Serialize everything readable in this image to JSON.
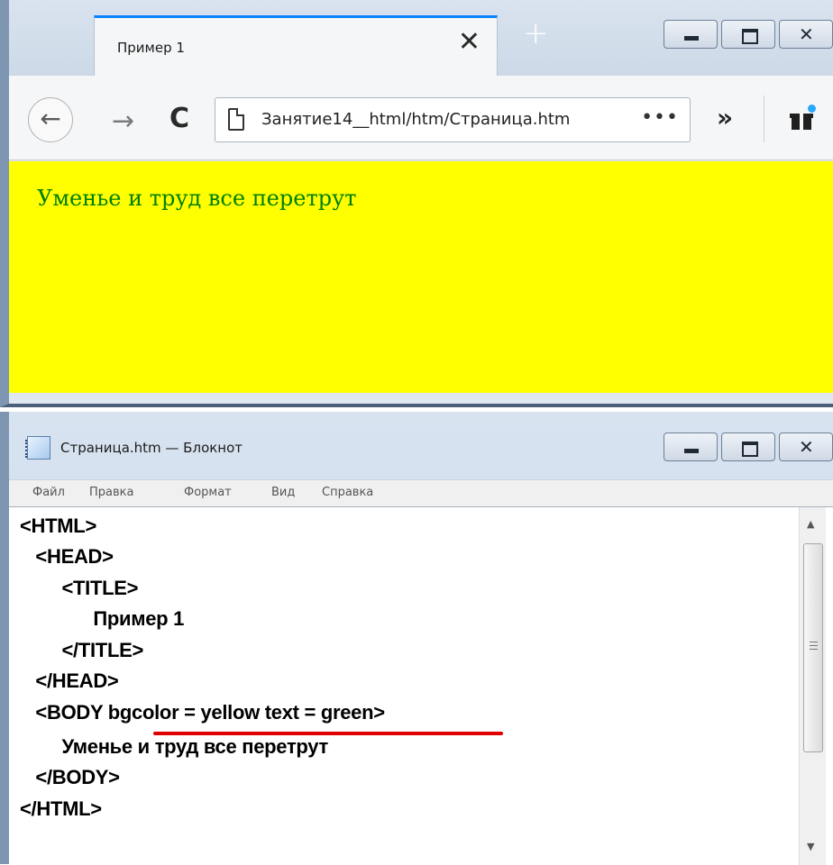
{
  "browser": {
    "tab_title": "Пример 1",
    "tab_close": "✕",
    "new_tab": "+",
    "url": "Занятие14__html/htm/Страница.htm",
    "url_more": "•••",
    "back": "←",
    "forward": "→",
    "reload": "C",
    "overflow": "»",
    "page_text": "Уменье и труд все перетрут",
    "page_bgcolor": "#ffff00",
    "page_textcolor": "#008000"
  },
  "notepad": {
    "title": "Страница.htm — Блокнот",
    "menu": [
      "Файл",
      "Правка",
      "Формат",
      "Вид",
      "Справка"
    ],
    "code_lines": [
      "<HTML>",
      "   <HEAD>",
      "        <TITLE>",
      "              Пример 1",
      "        </TITLE>",
      "   </HEAD>",
      "   <BODY bgcolor = yellow text = green>",
      "        Уменье и труд все перетрут",
      "   </BODY>",
      "</HTML>"
    ],
    "highlight_color": "#e00000"
  }
}
